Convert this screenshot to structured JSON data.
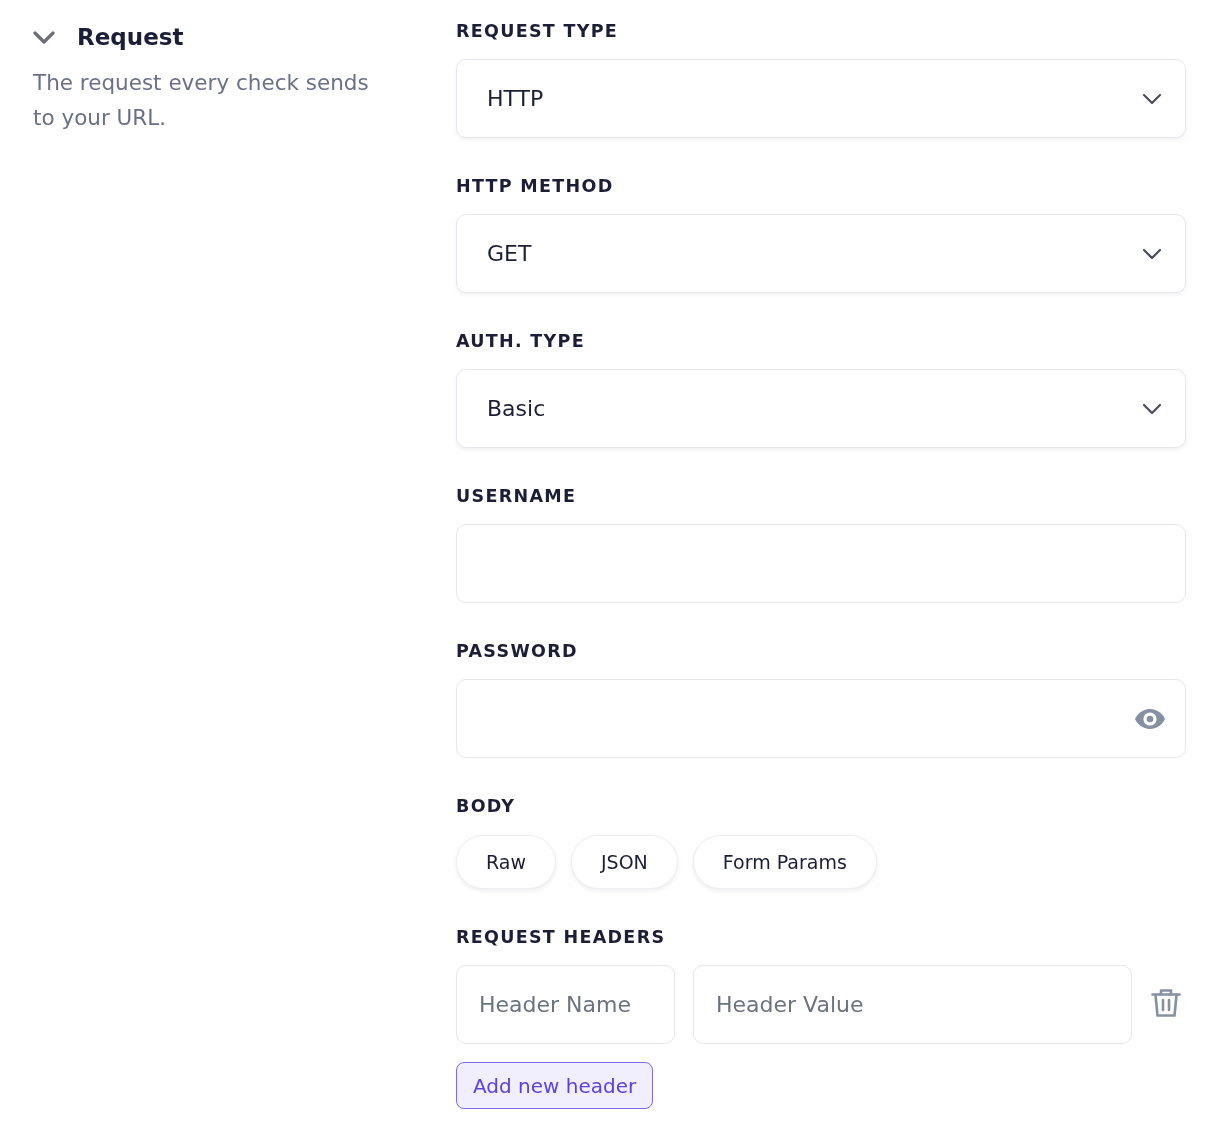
{
  "section": {
    "title": "Request",
    "expanded": true,
    "description": "The request every check sends to your URL."
  },
  "fields": [
    {
      "kind": "select",
      "label": "REQUEST TYPE",
      "value": "HTTP"
    },
    {
      "kind": "select",
      "label": "HTTP METHOD",
      "value": "GET"
    },
    {
      "kind": "select",
      "label": "AUTH. TYPE",
      "value": "Basic"
    },
    {
      "kind": "text",
      "label": "USERNAME"
    },
    {
      "kind": "password",
      "label": "PASSWORD"
    }
  ],
  "body": {
    "label": "BODY",
    "options": [
      {
        "label": "Raw",
        "selected": false
      },
      {
        "label": "JSON",
        "selected": false
      },
      {
        "label": "Form Params",
        "selected": false
      }
    ]
  },
  "headers": {
    "label": "REQUEST HEADERS",
    "rows": [
      {
        "name_placeholder": "Header Name",
        "value_placeholder": "Header Value"
      }
    ],
    "add_button": "Add new header"
  }
}
